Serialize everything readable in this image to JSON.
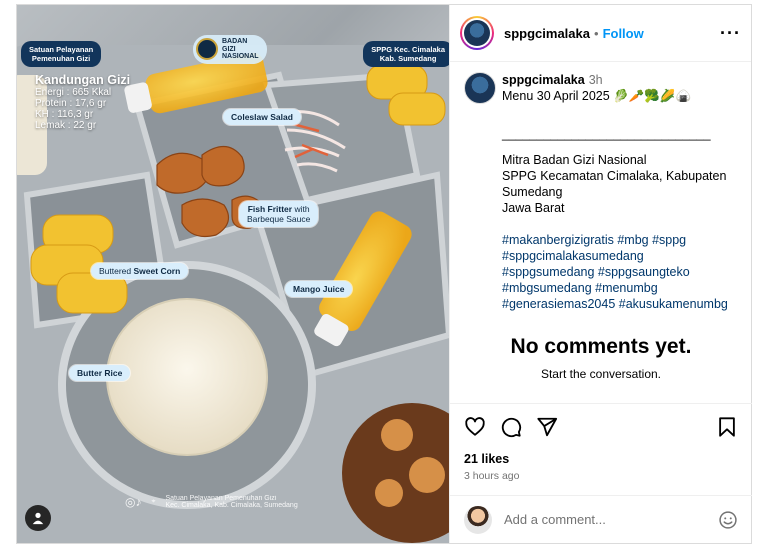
{
  "post": {
    "username": "sppgcimalaka",
    "follow_label": "Follow",
    "more_icon": "more-horizontal-icon",
    "time": "3h",
    "caption_lines": [
      "Menu 30 April 2025 🥬🥕🥦🌽🍙",
      "______________________________",
      "Mitra Badan Gizi Nasional",
      "SPPG Kecamatan Cimalaka, Kabupaten",
      "Sumedang",
      "Jawa Barat"
    ],
    "hashtag_lines": [
      "#makanbergizigratis #mbg #sppg",
      "#sppgcimalakasumedang",
      "#sppgsumedang #sppgsaungteko",
      "#mbgsumedang #menumbg",
      "#generasiemas2045 #akusukamenumbg"
    ],
    "no_comments_title": "No comments yet.",
    "no_comments_sub": "Start the conversation.",
    "likes": "21 likes",
    "posted_ago": "3 hours ago",
    "add_comment_placeholder": "Add a comment...",
    "accent": "#0095f6"
  },
  "photo": {
    "badge_left": [
      "Satuan Pelayanan",
      "Pemenuhan Gizi"
    ],
    "badge_right": [
      "SPPG Kec. Cimalaka",
      "Kab. Sumedang"
    ],
    "logo_text": [
      "BADAN",
      "GIZI",
      "NASIONAL"
    ],
    "nutrition_title": "Kandungan Gizi",
    "nutrition": [
      "Energi : 665 Kkal",
      "Protein : 17,6 gr",
      "KH : 116,3 gr",
      "Lemak : 22 gr"
    ],
    "labels": {
      "coleslaw": "Coleslaw Salad",
      "fish_a": "Fish Fritter",
      "fish_b": "with",
      "fish_c": "Barbeque Sauce",
      "corn_a": "Buttered",
      "corn_b": "Sweet Corn",
      "mango": "Mango Juice",
      "rice": "Butter Rice"
    },
    "footer_text": [
      "Satuan Pelayanan Pemenuhan Gizi",
      "Kec. Cimalaka, Kab. Cimalaka, Sumedang"
    ]
  }
}
